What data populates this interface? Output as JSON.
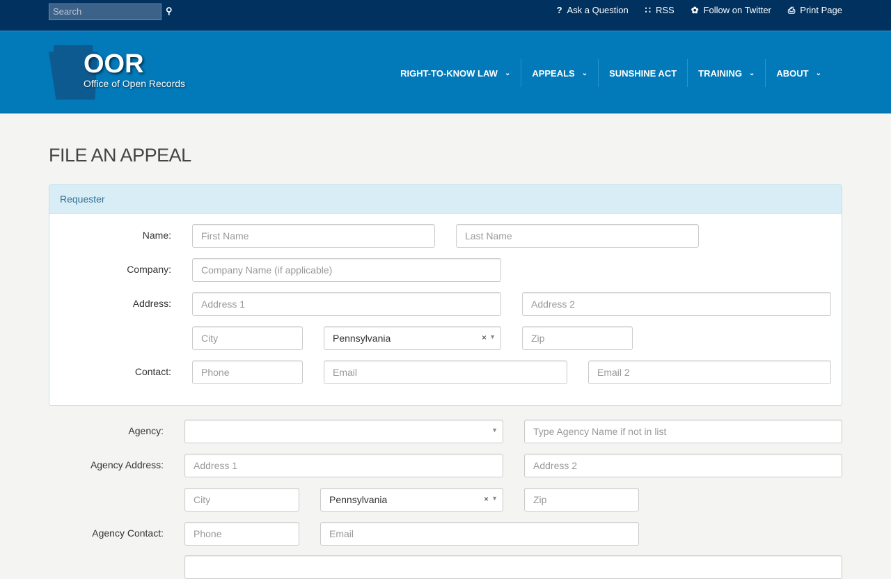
{
  "topbar": {
    "search_placeholder": "Search",
    "links": [
      "Ask a Question",
      "RSS",
      "Follow on Twitter",
      "Print Page"
    ]
  },
  "logo": {
    "title": "OOR",
    "subtitle": "Office of Open Records"
  },
  "nav": [
    "RIGHT-TO-KNOW LAW",
    "APPEALS",
    "SUNSHINE ACT",
    "TRAINING",
    "ABOUT"
  ],
  "page_title": "FILE AN APPEAL",
  "requester": {
    "heading": "Requester",
    "labels": {
      "name": "Name:",
      "company": "Company:",
      "address": "Address:",
      "contact": "Contact:"
    },
    "placeholders": {
      "first": "First Name",
      "last": "Last Name",
      "company": "Company Name (if applicable)",
      "addr1": "Address 1",
      "addr2": "Address 2",
      "city": "City",
      "zip": "Zip",
      "phone": "Phone",
      "email": "Email",
      "email2": "Email 2"
    },
    "state": "Pennsylvania"
  },
  "agency": {
    "labels": {
      "agency": "Agency:",
      "address": "Agency Address:",
      "contact": "Agency Contact:"
    },
    "placeholders": {
      "other": "Type Agency Name if not in list",
      "addr1": "Address 1",
      "addr2": "Address 2",
      "city": "City",
      "zip": "Zip",
      "phone": "Phone",
      "email": "Email"
    },
    "agency_value": "",
    "state": "Pennsylvania"
  }
}
